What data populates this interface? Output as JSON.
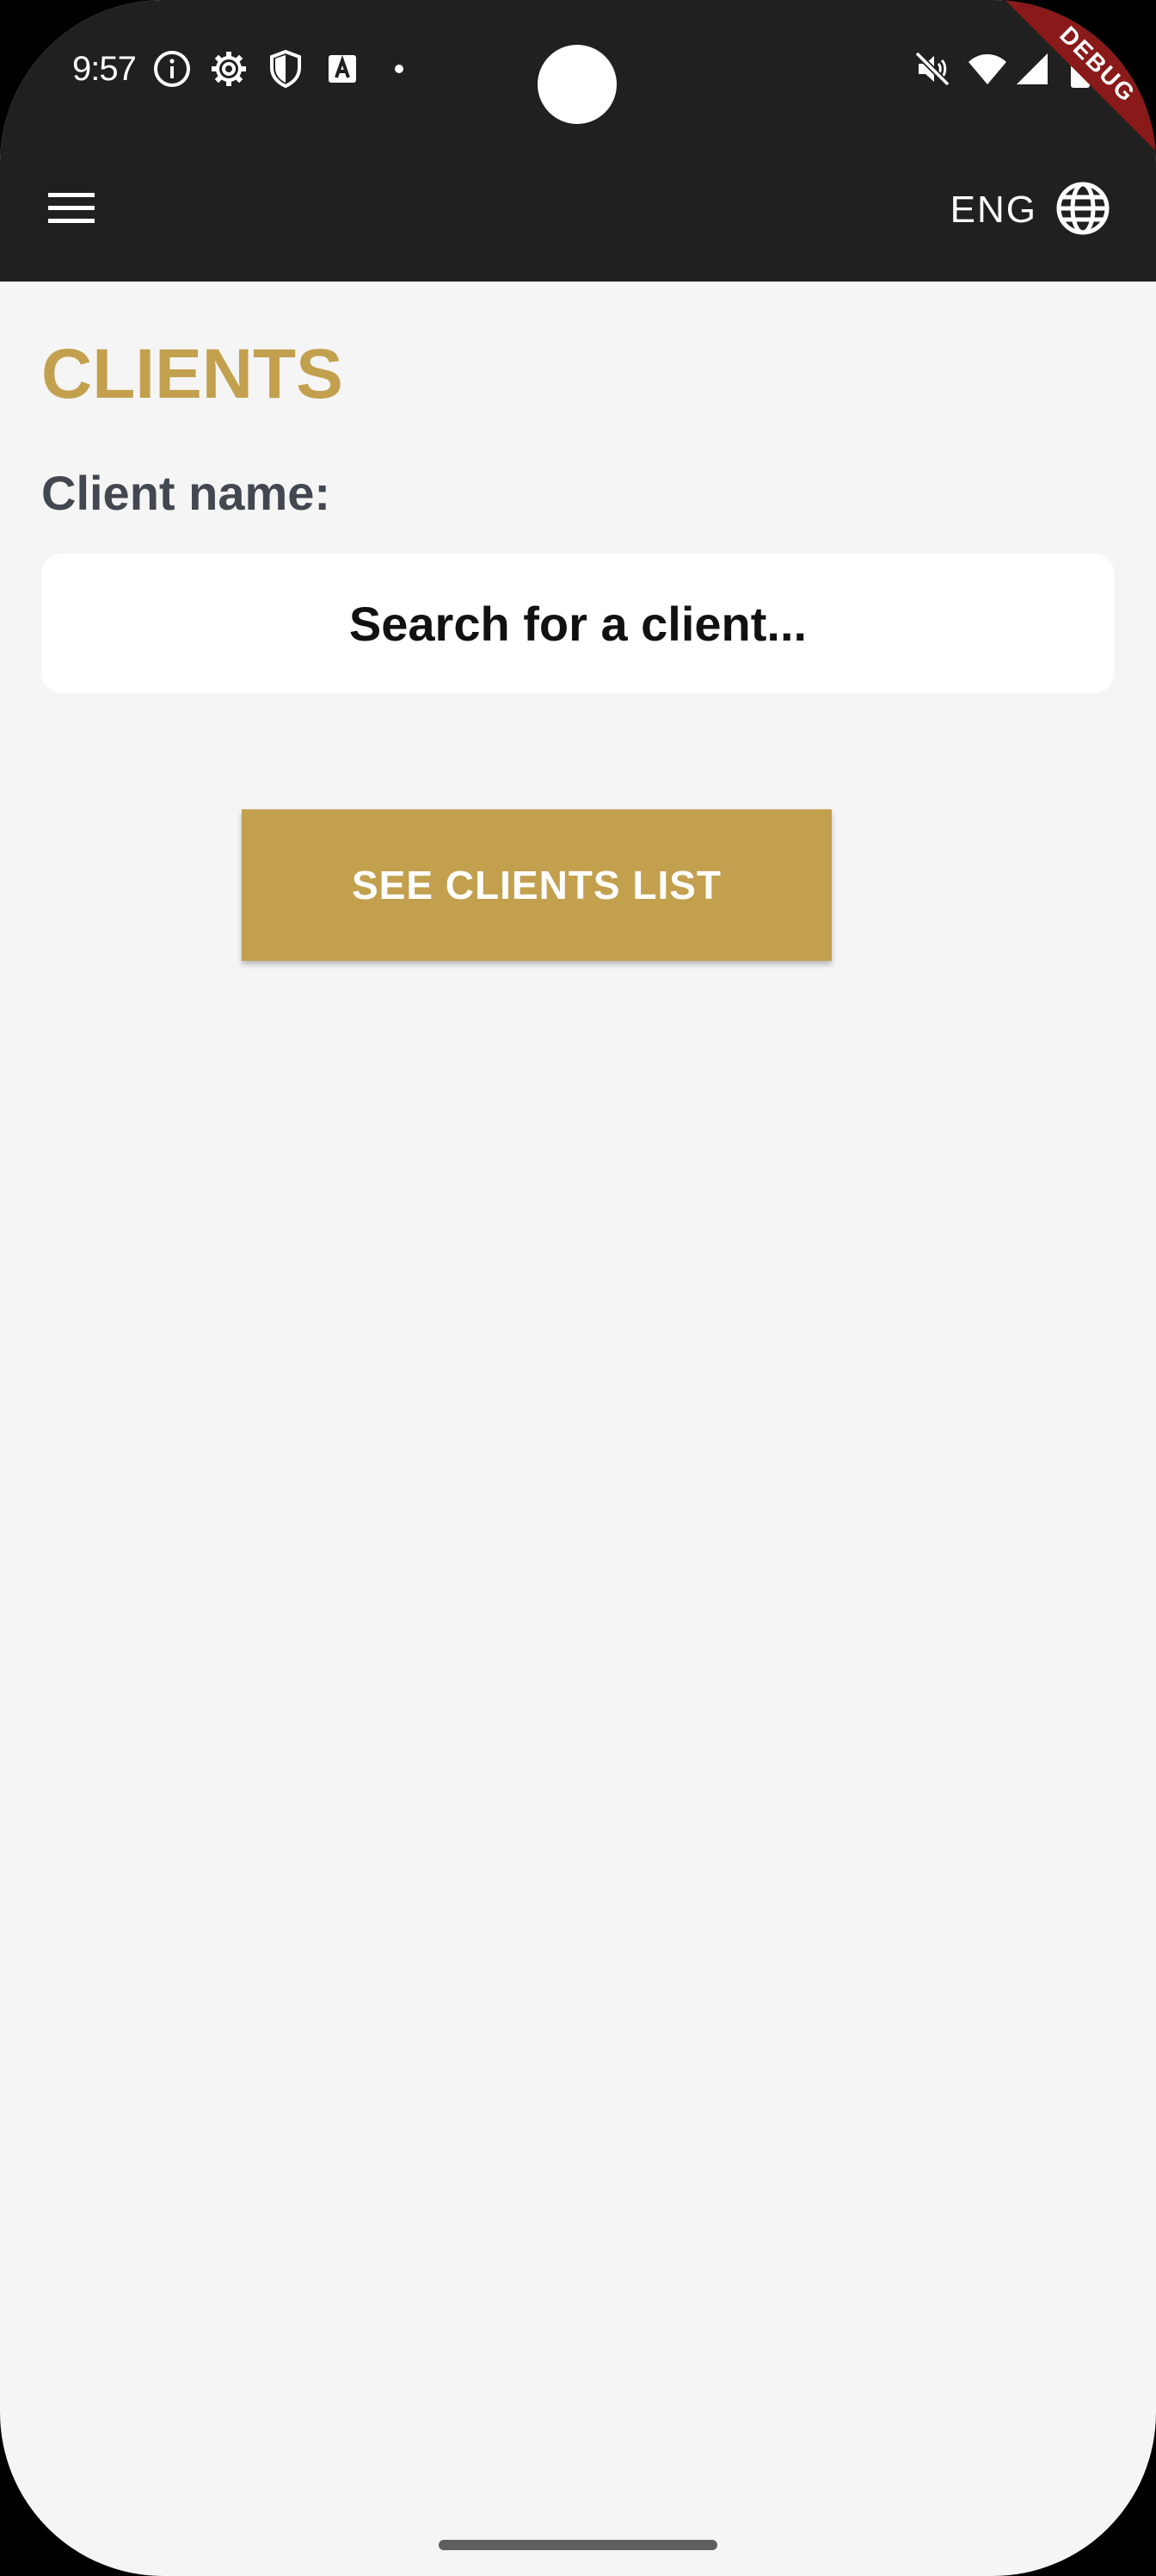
{
  "status_bar": {
    "time": "9:57",
    "left_icons": [
      "info-icon",
      "settings-gear-icon",
      "shield-icon",
      "text-a-icon",
      "notification-dot-icon"
    ],
    "right_icons": [
      "mute-icon",
      "wifi-icon",
      "signal-icon",
      "battery-icon"
    ],
    "debug_badge": "DEBUG"
  },
  "app_bar": {
    "menu_icon": "hamburger-menu-icon",
    "language_label": "ENG",
    "language_icon": "globe-icon"
  },
  "page": {
    "title": "CLIENTS",
    "client_name_label": "Client name:",
    "search_placeholder": "Search for a client...",
    "see_clients_button": "SEE CLIENTS LIST"
  },
  "colors": {
    "accent_gold": "#c2a04e",
    "app_bar_dark": "#202020",
    "background": "#f5f5f5",
    "debug_red": "#8a1a1a"
  }
}
